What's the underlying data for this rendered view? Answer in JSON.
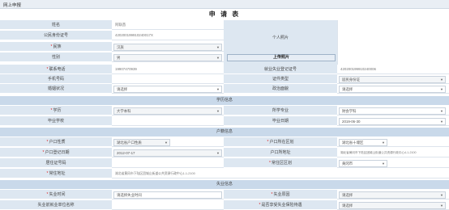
{
  "window": {
    "tab_title": "网上申报"
  },
  "form_title": "申 请 表",
  "basic": {
    "name_label": "姓名",
    "name_value": "阿联酋",
    "id_label": "公民身份证号",
    "id_value": "420200199910240017X",
    "photo_label": "个人照片",
    "ethnic_label": "民族",
    "ethnic_value": "汉族",
    "gender_label": "性别",
    "gender_value": "男",
    "upload_label": "上传照片",
    "phone_label": "联系电话",
    "phone_value": "19907470939",
    "emp_reg_label": "就业失业登记证号",
    "emp_reg_value": "420200199910240006",
    "mobile_label": "手机号码",
    "mobile_value": "",
    "cert_type_label": "证件类型",
    "cert_type_value": "居民身份证",
    "marital_label": "婚姻状况",
    "marital_value": "请选择",
    "political_label": "政治面貌",
    "political_value": "请选择"
  },
  "edu_section": "学历信息",
  "edu": {
    "degree_label": "学历",
    "degree_value": "大学本科",
    "major_label": "所学专业",
    "major_value": "财会学科",
    "school_label": "毕业学校",
    "school_value": "",
    "grad_date_label": "毕业日期",
    "grad_date_value": "2019-06-30"
  },
  "household_section": "户籍信息",
  "household": {
    "type_label": "户口性质",
    "type_value": "湖北省户口性质",
    "region_label": "户口所在区划",
    "region_value": "湖北省十堰区",
    "reg_date_label": "户口登记日期",
    "reg_date_value": "2012-07-17",
    "address_label": "户口所地址",
    "address_value": "湖北省黄冈市下陆区团城山街道公共资源行政中心4-1-2100",
    "card_label": "居住证号码",
    "card_value": "",
    "residence_region_label": "常住区区划",
    "residence_region_value": "黄冈市",
    "residence_addr_label": "常住地址",
    "residence_addr_value": "湖北省黄冈市下陆区团城山街道公共资源行政中心1-1-2100"
  },
  "unemp_section": "失业信息",
  "unemp": {
    "time_label": "失业时间",
    "time_value": "请选择失业时间",
    "reason_label": "失业原因",
    "reason_value": "请选择",
    "duration_label": "失业前就业单位名称",
    "duration_value": "",
    "benefit_label": "是否享受失业保险待遇",
    "benefit_value": "请选择"
  }
}
